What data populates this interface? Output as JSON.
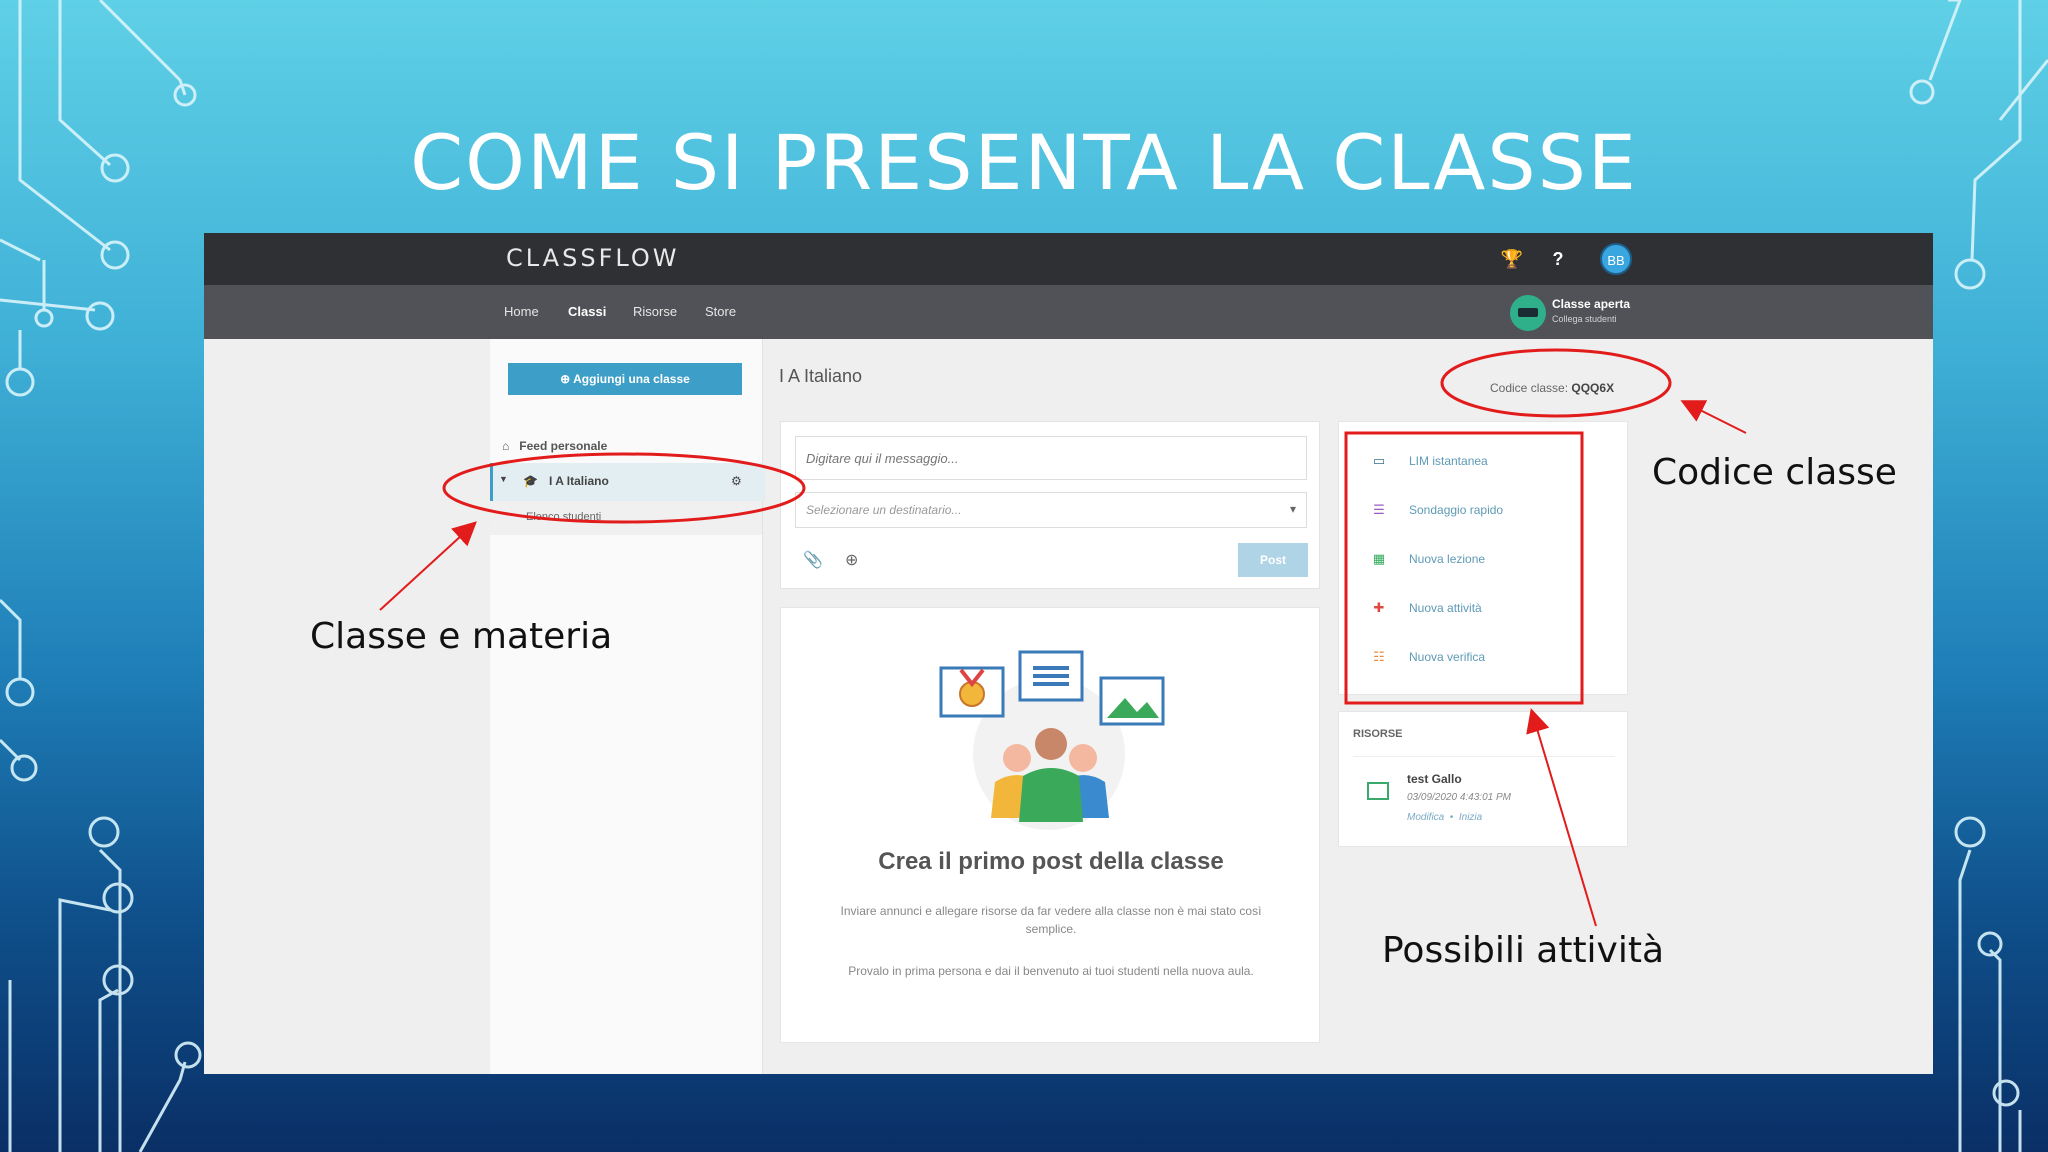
{
  "slide": {
    "title": "COME SI PRESENTA LA CLASSE"
  },
  "app": {
    "logo": "CLASSFLOW",
    "user_initials": "BB",
    "nav": [
      "Home",
      "Classi",
      "Risorse",
      "Store"
    ],
    "active_nav": "Classi",
    "open_class": {
      "title": "Classe aperta",
      "subtitle": "Collega studenti"
    }
  },
  "sidebar": {
    "add_button": "Aggiungi una classe",
    "feed": "Feed personale",
    "class_name": "I A Italiano",
    "students": "Elenco studenti"
  },
  "main": {
    "class_title": "I A Italiano",
    "message_placeholder": "Digitare qui il messaggio...",
    "recipient_placeholder": "Selezionare un destinatario...",
    "post_button": "Post",
    "empty_title": "Crea il primo post della classe",
    "empty_p1": "Inviare annunci e allegare risorse da far vedere alla classe non è mai stato così semplice.",
    "empty_p2": "Provalo in prima persona e dai il benvenuto ai tuoi studenti nella nuova aula."
  },
  "class_code": {
    "label": "Codice classe:",
    "value": "QQQ6X"
  },
  "activities": [
    {
      "label": "LIM istantanea",
      "icon": "whiteboard-icon",
      "color": "#3a6e8e"
    },
    {
      "label": "Sondaggio rapido",
      "icon": "poll-icon",
      "color": "#9b59c4"
    },
    {
      "label": "Nuova lezione",
      "icon": "lesson-icon",
      "color": "#2faa5a"
    },
    {
      "label": "Nuova attività",
      "icon": "activity-icon",
      "color": "#e0483e"
    },
    {
      "label": "Nuova verifica",
      "icon": "quiz-icon",
      "color": "#f08a3a"
    }
  ],
  "resources": {
    "heading": "RISORSE",
    "item": {
      "name": "test Gallo",
      "date": "03/09/2020 4:43:01 PM",
      "edit": "Modifica",
      "start": "Inizia"
    }
  },
  "annotations": {
    "class_subject": "Classe e materia",
    "class_code": "Codice classe",
    "activities": "Possibili attività"
  }
}
